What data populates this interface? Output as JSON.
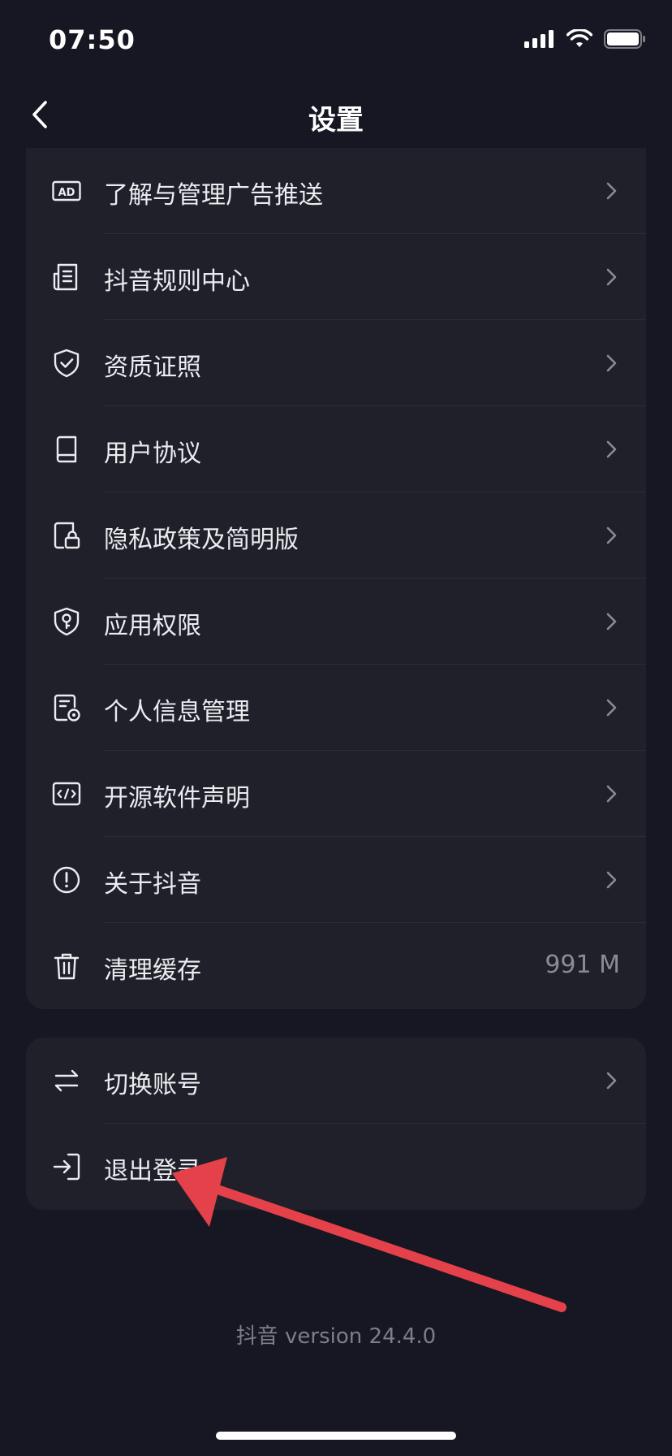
{
  "status_bar": {
    "time": "07:50"
  },
  "nav": {
    "title": "设置"
  },
  "group1": {
    "items": [
      {
        "label": "了解与管理广告推送",
        "icon": "ad-icon"
      },
      {
        "label": "抖音规则中心",
        "icon": "document-list-icon"
      },
      {
        "label": "资质证照",
        "icon": "shield-check-icon"
      },
      {
        "label": "用户协议",
        "icon": "book-icon"
      },
      {
        "label": "隐私政策及简明版",
        "icon": "privacy-lock-icon"
      },
      {
        "label": "应用权限",
        "icon": "shield-key-icon"
      },
      {
        "label": "个人信息管理",
        "icon": "document-settings-icon"
      },
      {
        "label": "开源软件声明",
        "icon": "code-icon"
      },
      {
        "label": "关于抖音",
        "icon": "info-circle-icon"
      },
      {
        "label": "清理缓存",
        "icon": "trash-icon",
        "value": "991 M"
      }
    ]
  },
  "group2": {
    "items": [
      {
        "label": "切换账号",
        "icon": "switch-arrows-icon"
      },
      {
        "label": "退出登录",
        "icon": "logout-icon"
      }
    ]
  },
  "footer": {
    "version": "抖音 version 24.4.0"
  },
  "colors": {
    "background": "#161722",
    "card": "#1f2029",
    "annotation_arrow": "#e5414a"
  }
}
